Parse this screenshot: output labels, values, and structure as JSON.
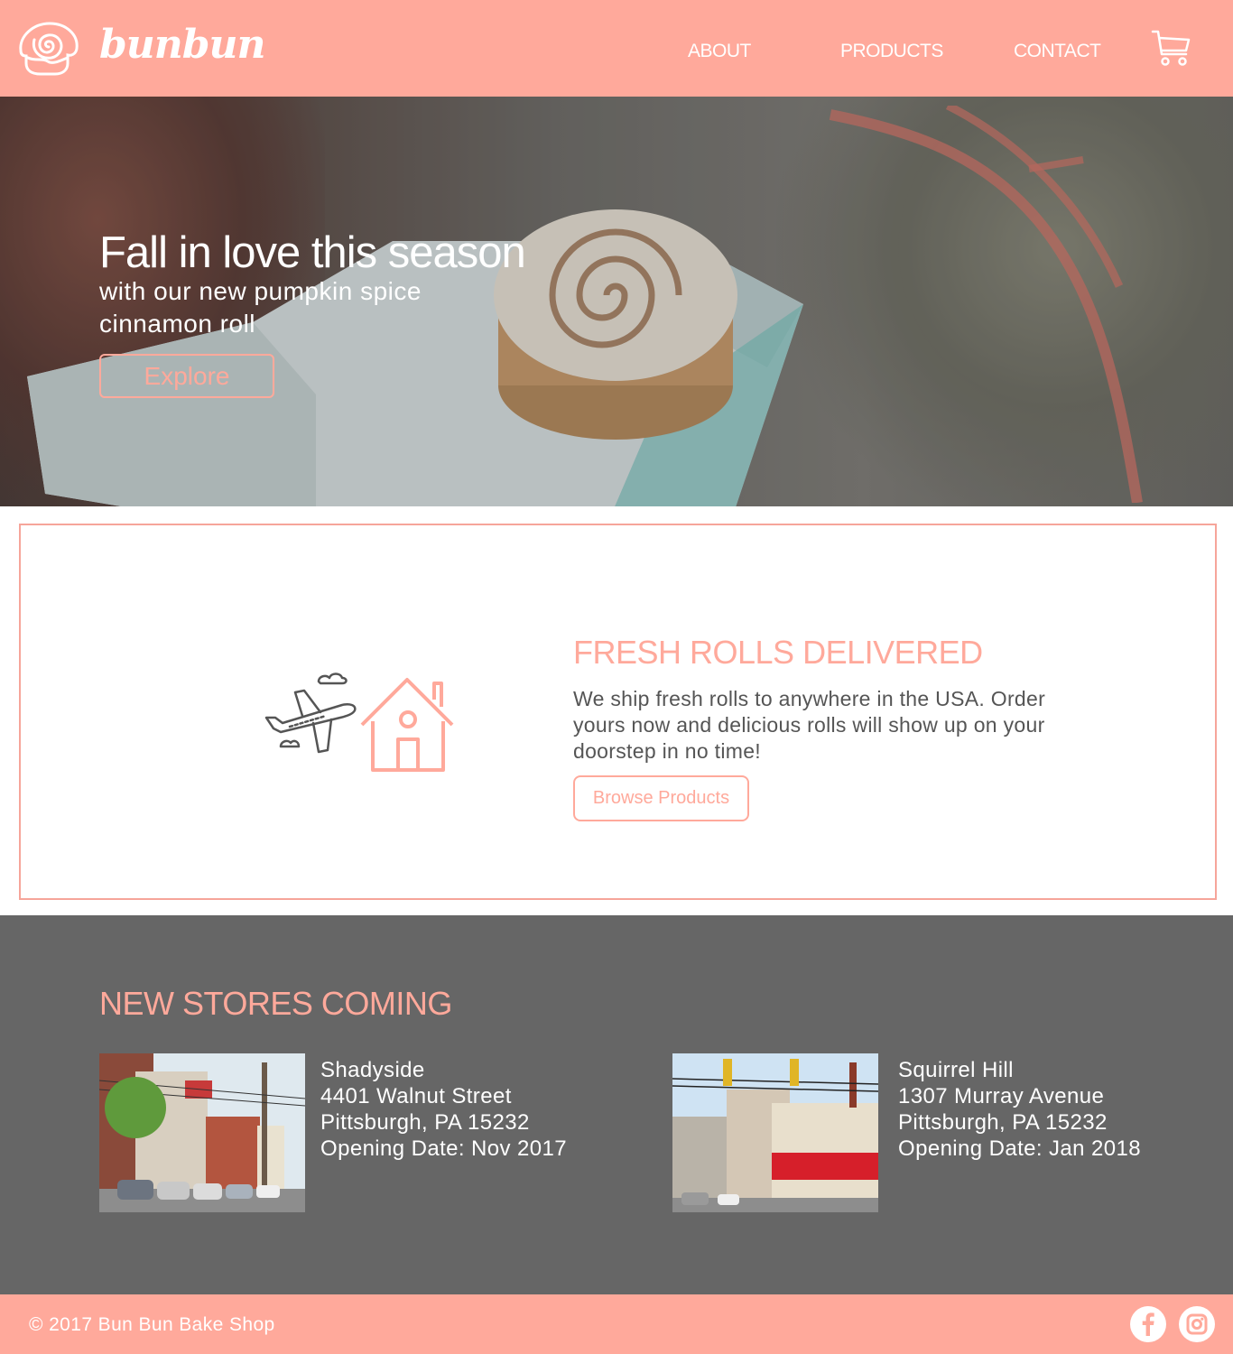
{
  "header": {
    "brand": "bunbun",
    "nav": [
      "ABOUT",
      "PRODUCTS",
      "CONTACT"
    ],
    "logo_icon": "cinnamon-roll-icon",
    "cart_icon": "shopping-cart-icon"
  },
  "hero": {
    "title": "Fall in love this season",
    "subtitle": "with our new pumpkin spice cinnamon roll",
    "button": "Explore"
  },
  "delivery": {
    "title": "FRESH ROLLS DELIVERED",
    "text": "We ship fresh rolls to anywhere in the USA. Order yours now and delicious rolls will show up on your doorstep in no time!",
    "button": "Browse Products",
    "icon": "plane-to-house-icon"
  },
  "stores": {
    "title": "NEW STORES COMING",
    "items": [
      {
        "name": "Shadyside",
        "street": "4401 Walnut Street",
        "city": "Pittsburgh, PA 15232",
        "opening": "Opening Date: Nov 2017"
      },
      {
        "name": "Squirrel Hill",
        "street": "1307 Murray Avenue",
        "city": "Pittsburgh, PA 15232",
        "opening": "Opening Date: Jan 2018"
      }
    ]
  },
  "footer": {
    "copyright": "© 2017 Bun Bun Bake Shop",
    "social": [
      "facebook-icon",
      "instagram-icon"
    ]
  },
  "colors": {
    "accent": "#ffa99b",
    "stores_bg": "#666666",
    "text_dark": "#555555"
  }
}
